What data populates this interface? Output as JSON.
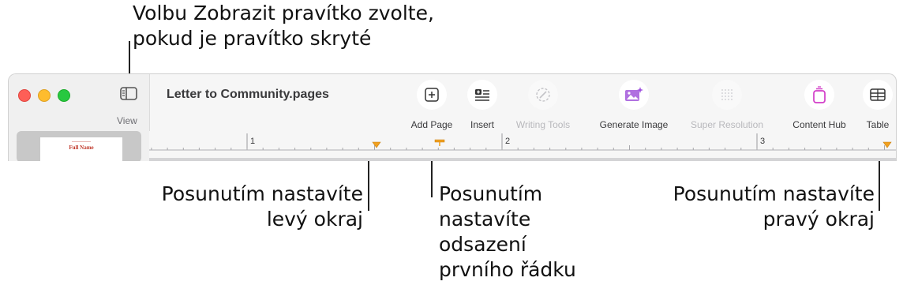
{
  "callouts": {
    "view": "Volbu Zobrazit pravítko zvolte,\npokud je pravítko skryté",
    "left_margin": "Posunutím nastavíte\nlevý okraj",
    "first_line": "Posunutím\nnastavíte\nodsazení\nprvního řádku",
    "right_margin": "Posunutím nastavíte\npravý okraj"
  },
  "sidebar": {
    "view_label": "View",
    "thumbnail_title": "Full Name"
  },
  "document": {
    "title": "Letter to Community.pages"
  },
  "toolbar": {
    "add_page": "Add Page",
    "insert": "Insert",
    "writing_tools": "Writing Tools",
    "generate_image": "Generate Image",
    "super_resolution": "Super Resolution",
    "content_hub": "Content Hub",
    "table": "Table"
  },
  "ruler": {
    "numbers": [
      "1",
      "2",
      "3"
    ]
  },
  "colors": {
    "marker": "#f0a020",
    "accent_pink": "#d23cc8",
    "accent_purple": "#a050e0",
    "traffic_red": "#fe5f57",
    "traffic_yellow": "#febc2e",
    "traffic_green": "#28c840"
  }
}
